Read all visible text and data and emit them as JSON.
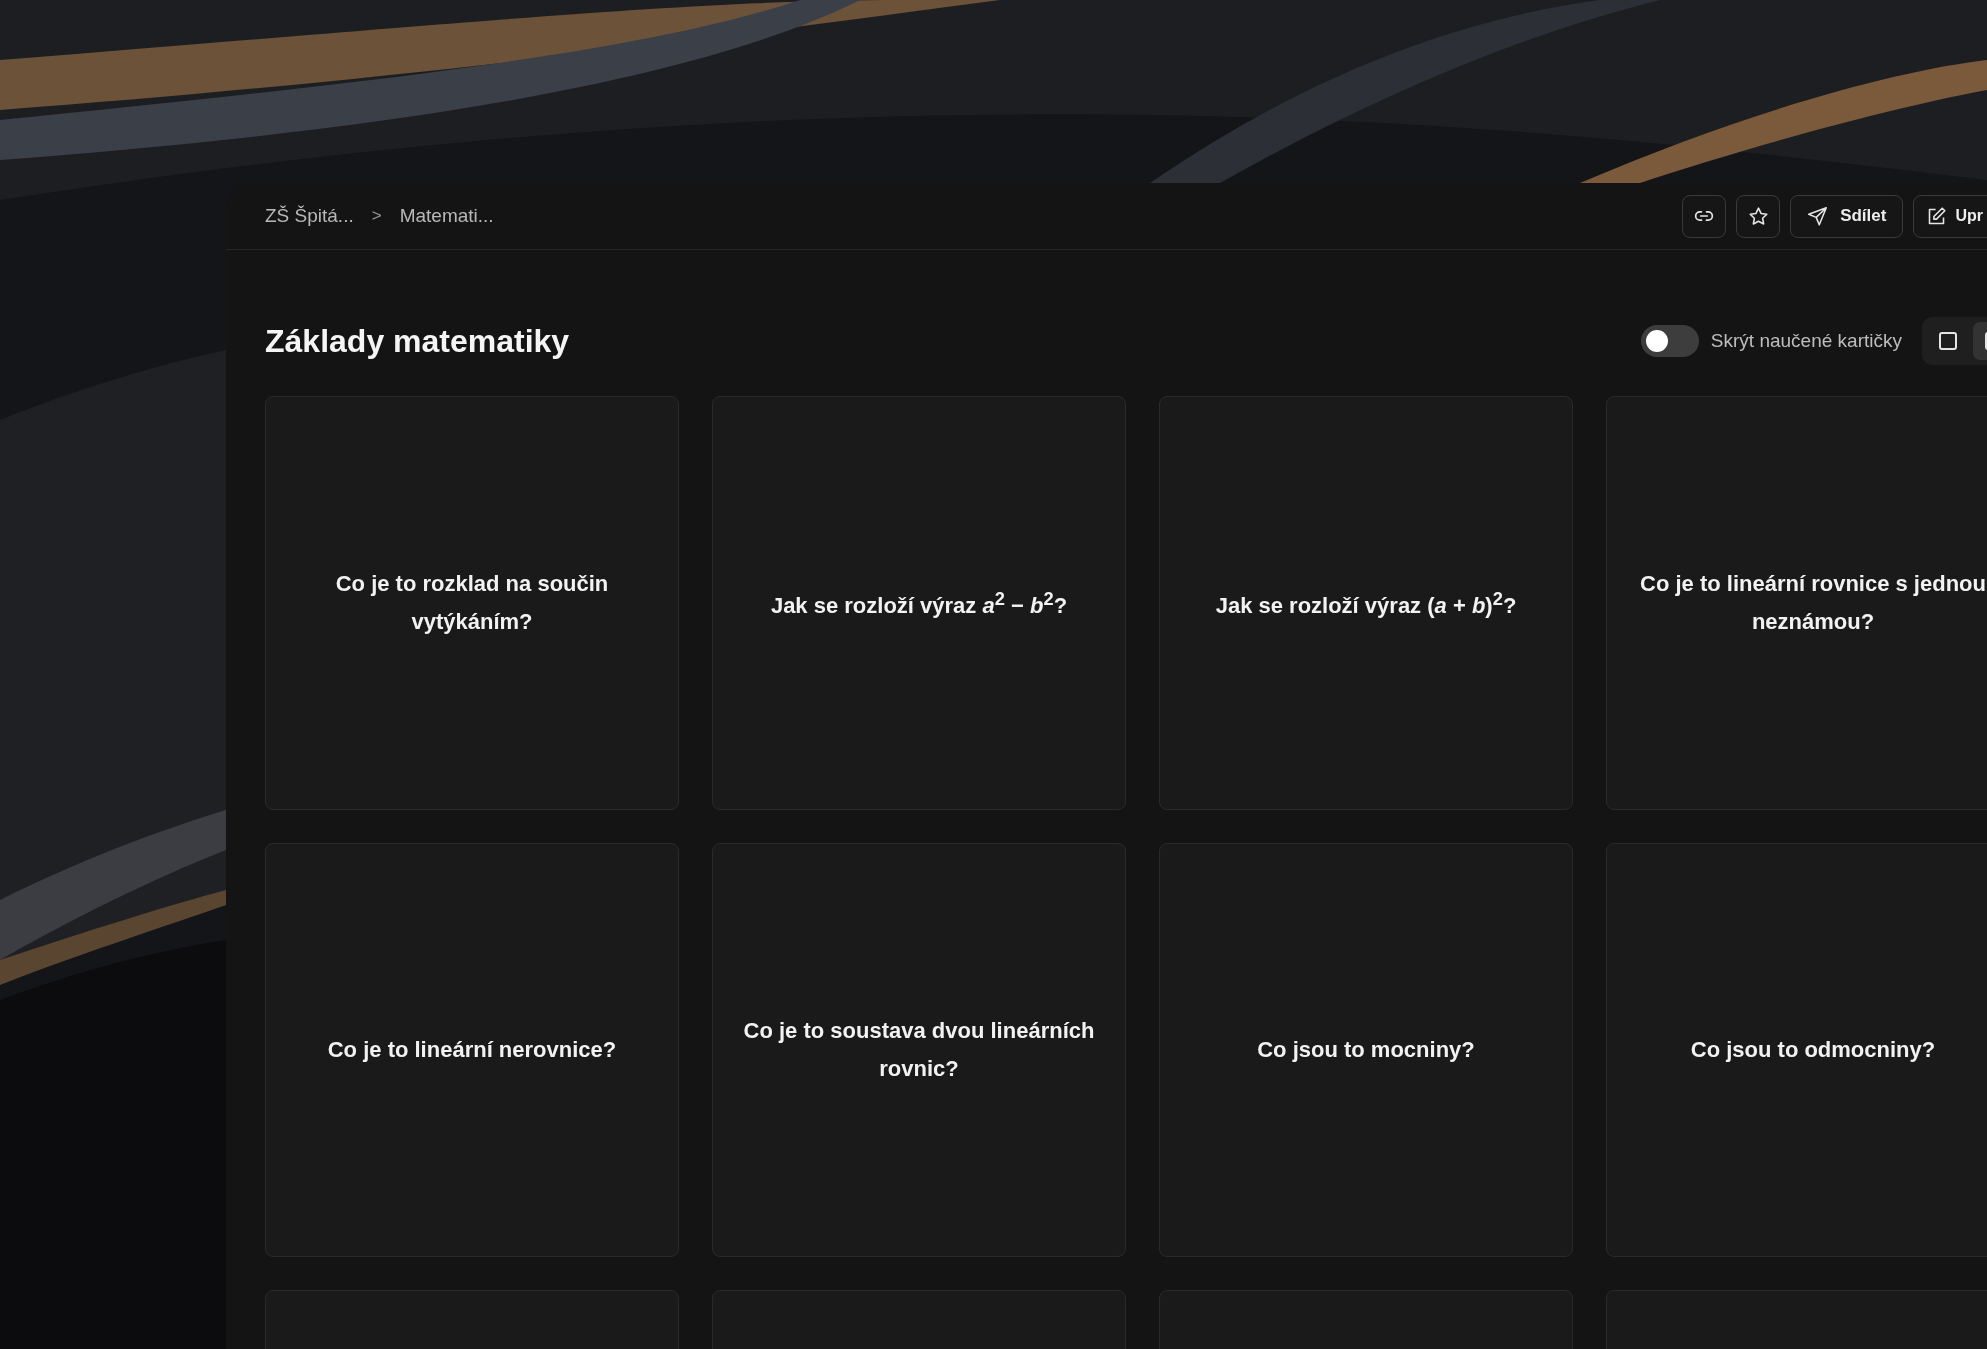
{
  "breadcrumb": [
    "ZŠ Špitá...",
    "Matemati..."
  ],
  "breadcrumb_separator": ">",
  "header_actions": [
    {
      "kind": "link"
    },
    {
      "kind": "star"
    },
    {
      "kind": "share",
      "label": "Sdílet"
    },
    {
      "kind": "edit",
      "label": "Upr"
    }
  ],
  "title": "Základy matematiky",
  "hide_learned": {
    "label": "Skrýt naučené kartičky",
    "on": false
  },
  "view_modes": [
    {
      "kind": "single",
      "selected": false
    },
    {
      "kind": "grid",
      "selected": true
    }
  ],
  "cards": [
    {
      "kind": "question",
      "text": "Co je to rozklad na součin vytýkáním?"
    },
    {
      "kind": "question",
      "text": "Jak se rozloží výraz *a*$^{2}$ − *b*$^{2}$?"
    },
    {
      "kind": "question",
      "text": "Jak se rozloží výraz (*a* + *b*)$^{2}$?"
    },
    {
      "kind": "question",
      "text": "Co je to lineární rovnice s jednou neznámou?"
    },
    {
      "kind": "question",
      "text": "Co je to lineární nerovnice?"
    },
    {
      "kind": "question",
      "text": "Co je to soustava dvou lineárních rovnic?"
    },
    {
      "kind": "question",
      "text": "Co jsou to mocniny?"
    },
    {
      "kind": "question",
      "text": "Co jsou to odmocniny?"
    },
    {
      "kind": "cut"
    },
    {
      "kind": "cut"
    },
    {
      "kind": "cut"
    },
    {
      "kind": "cut"
    }
  ]
}
